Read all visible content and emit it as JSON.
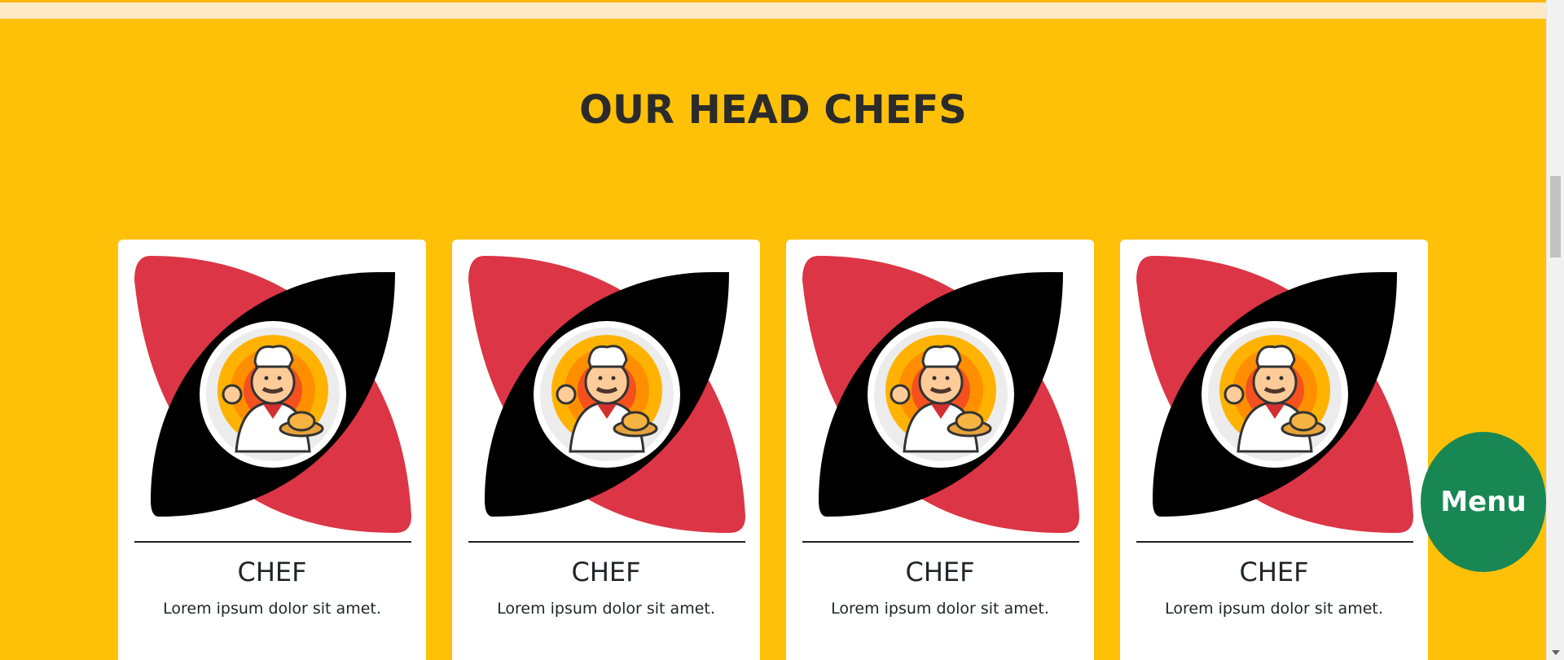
{
  "section": {
    "title": "OUR HEAD CHEFS"
  },
  "chefs": [
    {
      "name": "CHEF",
      "description": "Lorem ipsum dolor sit amet.",
      "image_icon": "chef-mascot-icon"
    },
    {
      "name": "CHEF",
      "description": "Lorem ipsum dolor sit amet.",
      "image_icon": "chef-mascot-icon"
    },
    {
      "name": "CHEF",
      "description": "Lorem ipsum dolor sit amet.",
      "image_icon": "chef-mascot-icon"
    },
    {
      "name": "CHEF",
      "description": "Lorem ipsum dolor sit amet.",
      "image_icon": "chef-mascot-icon"
    }
  ],
  "menu_button": {
    "label": "Menu"
  },
  "colors": {
    "background": "#ffc107",
    "card": "#ffffff",
    "petal_red": "#dc3545",
    "petal_black": "#000000",
    "menu_button": "#198754",
    "title_text": "#2b2b2b"
  }
}
